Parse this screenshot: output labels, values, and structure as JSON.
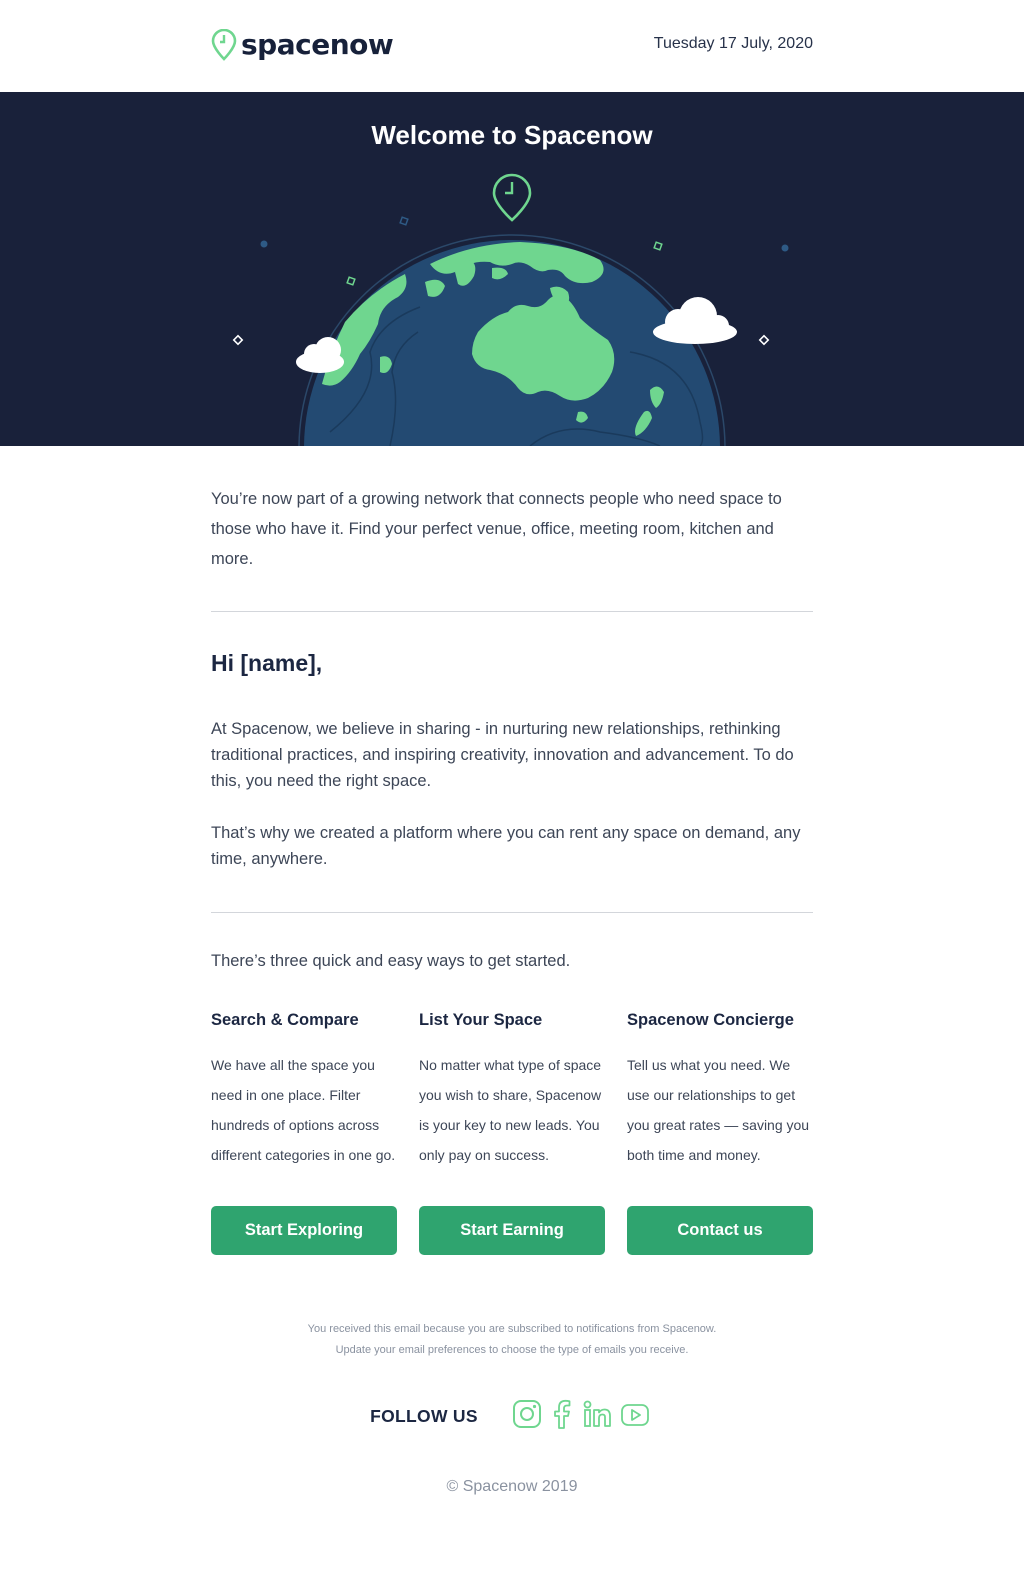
{
  "header": {
    "brand": "spacenow",
    "date": "Tuesday 17 July, 2020"
  },
  "hero": {
    "title": "Welcome to Spacenow"
  },
  "intro": "You’re now part of a growing network that connects people who need space to those who have it. Find your perfect venue, office, meeting room, kitchen and more.",
  "greeting": "Hi [name],",
  "body": {
    "p1": "At Spacenow, we believe in sharing - in nurturing new relationships, rethinking traditional practices, and inspiring creativity, innovation and advancement. To do this, you need the right space.",
    "p2": "That’s why we created a platform where you can rent any space on demand, any time, anywhere."
  },
  "started": "There’s three quick and easy ways to get started.",
  "columns": [
    {
      "title": "Search & Compare",
      "text": "We have all the space you need in one place. Filter hundreds of options across different categories in one go.",
      "button": "Start Exploring"
    },
    {
      "title": "List Your Space",
      "text": "No matter what type of space you wish to share, Spacenow is  your key to new leads. You only pay on success.",
      "button": "Start Earning"
    },
    {
      "title": "Spacenow Concierge",
      "text": "Tell us what you need. We use our relationships to get you great rates — saving you both time and money.",
      "button": "Contact us"
    }
  ],
  "footer": {
    "notice1": "You received this email because you are subscribed to notifications from Spacenow.",
    "notice2": "Update your email preferences to choose the type of emails you receive.",
    "follow": "FOLLOW US",
    "social_icons": [
      "instagram-icon",
      "facebook-icon",
      "linkedin-icon",
      "youtube-icon"
    ],
    "copyright": "© Spacenow 2019"
  },
  "colors": {
    "brand_green": "#2fa46f",
    "light_green": "#6fd68f",
    "navy": "#19213a",
    "ocean": "#234a72"
  }
}
